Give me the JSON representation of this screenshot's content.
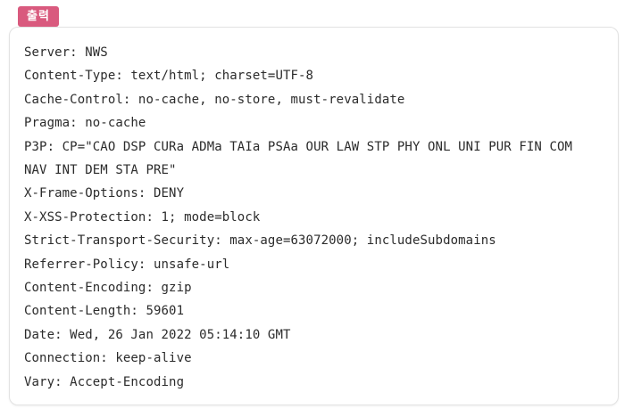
{
  "tag": {
    "label": "출력",
    "color": "#d95a7e"
  },
  "output": {
    "lines": [
      "Server: NWS",
      "Content-Type: text/html; charset=UTF-8",
      "Cache-Control: no-cache, no-store, must-revalidate",
      "Pragma: no-cache",
      "P3P: CP=\"CAO DSP CURa ADMa TAIa PSAa OUR LAW STP PHY ONL UNI PUR FIN COM",
      "NAV INT DEM STA PRE\"",
      "X-Frame-Options: DENY",
      "X-XSS-Protection: 1; mode=block",
      "Strict-Transport-Security: max-age=63072000; includeSubdomains",
      "Referrer-Policy: unsafe-url",
      "Content-Encoding: gzip",
      "Content-Length: 59601",
      "Date: Wed, 26 Jan 2022 05:14:10 GMT",
      "Connection: keep-alive",
      "Vary: Accept-Encoding"
    ]
  }
}
